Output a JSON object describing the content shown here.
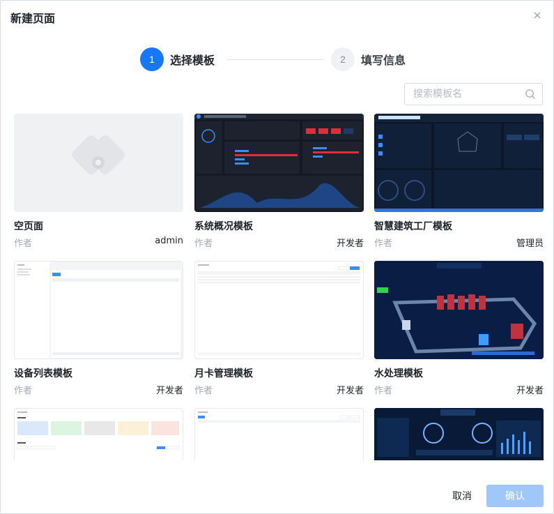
{
  "dialog": {
    "title": "新建页面",
    "close_icon": "close-icon"
  },
  "steps": [
    {
      "number": "1",
      "label": "选择模板",
      "active": true
    },
    {
      "number": "2",
      "label": "填写信息",
      "active": false
    }
  ],
  "search": {
    "placeholder": "搜索模板名",
    "value": "",
    "icon": "search-icon"
  },
  "author_label": "作者",
  "templates": [
    {
      "name": "空页面",
      "author": "admin"
    },
    {
      "name": "系统概况模板",
      "author": "开发者"
    },
    {
      "name": "智慧建筑工厂模板",
      "author": "管理员"
    },
    {
      "name": "设备列表模板",
      "author": "开发者"
    },
    {
      "name": "月卡管理模板",
      "author": "开发者"
    },
    {
      "name": "水处理模板",
      "author": "开发者"
    },
    {
      "name": "",
      "author": ""
    },
    {
      "name": "",
      "author": ""
    },
    {
      "name": "",
      "author": ""
    }
  ],
  "footer": {
    "cancel_label": "取消",
    "confirm_label": "确认"
  },
  "colors": {
    "primary": "#1677ff",
    "confirm_disabled": "#9fc8f8"
  }
}
